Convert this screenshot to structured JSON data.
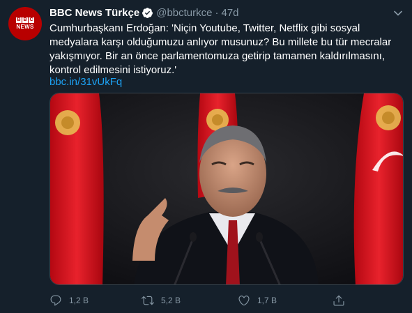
{
  "tweet": {
    "display_name": "BBC News Türkçe",
    "handle": "@bbcturkce",
    "separator": "·",
    "time": "47d",
    "text_lines": [
      "Cumhurbaşkanı Erdoğan: 'Niçin Youtube, Twitter, Netflix gibi sosyal",
      "medyalara karşı olduğumuzu anlıyor musunuz? Bu millete bu tür mecralar",
      "yakışmıyor. Bir an önce parlamentomuza getirip tamamen kaldırılmasını,",
      "kontrol edilmesini istiyoruz.'"
    ],
    "link": "bbc.in/31vUkFq"
  },
  "avatar": {
    "letters": [
      "B",
      "B",
      "C"
    ],
    "word": "NEWS",
    "color": "#b80000"
  },
  "actions": {
    "reply_count": "1,2 B",
    "retweet_count": "5,2 B",
    "like_count": "1,7 B"
  },
  "icons": {
    "verified": "verified-badge-icon",
    "caret": "chevron-down-icon",
    "reply": "reply-icon",
    "retweet": "retweet-icon",
    "like": "heart-icon",
    "share": "share-icon"
  },
  "colors": {
    "background": "#15202b",
    "accent": "#1da1f2",
    "muted": "#8899a6",
    "flag_red": "#e30a17"
  }
}
